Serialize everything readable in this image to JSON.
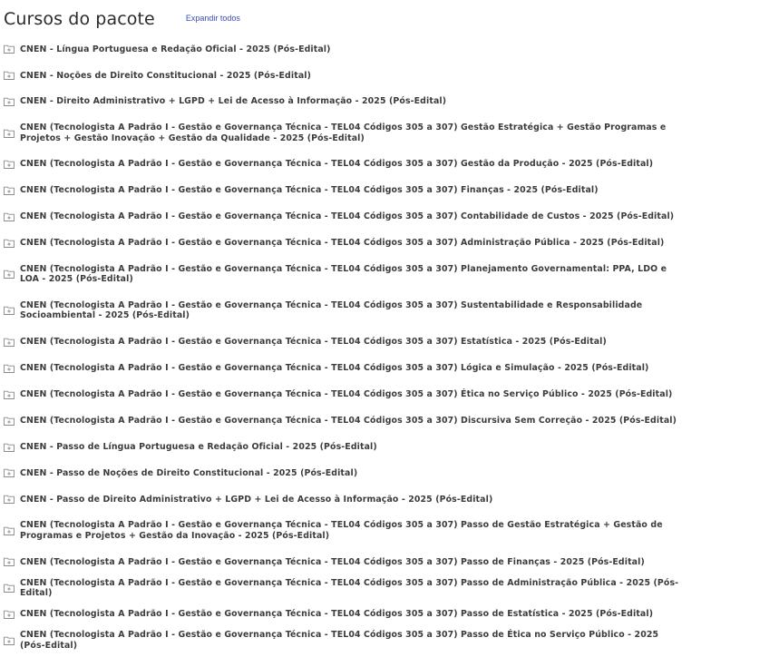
{
  "header": {
    "title": "Cursos do pacote",
    "expand_label": "Expandir todos"
  },
  "icons": {
    "item_icon": "folder-plus-icon"
  },
  "colors": {
    "link": "#3b4cb8",
    "text": "#3c3c3c",
    "icon": "#8a8a8a"
  },
  "courses": [
    "CNEN - Língua Portuguesa e Redação Oficial - 2025 (Pós-Edital)",
    "CNEN - Noções de Direito Constitucional - 2025 (Pós-Edital)",
    "CNEN - Direito Administrativo + LGPD + Lei de Acesso à Informação - 2025 (Pós-Edital)",
    "CNEN (Tecnologista A Padrão I - Gestão e Governança Técnica - TEL04 Códigos 305 a 307) Gestão Estratégica + Gestão Programas e Projetos + Gestão Inovação + Gestão da Qualidade - 2025 (Pós-Edital)",
    "CNEN (Tecnologista A Padrão I - Gestão e Governança Técnica - TEL04 Códigos 305 a 307) Gestão da Produção - 2025 (Pós-Edital)",
    "CNEN (Tecnologista A Padrão I - Gestão e Governança Técnica - TEL04 Códigos 305 a 307) Finanças - 2025 (Pós-Edital)",
    "CNEN (Tecnologista A Padrão I - Gestão e Governança Técnica - TEL04 Códigos 305 a 307) Contabilidade de Custos - 2025 (Pós-Edital)",
    "CNEN (Tecnologista A Padrão I - Gestão e Governança Técnica - TEL04 Códigos 305 a 307) Administração Pública - 2025 (Pós-Edital)",
    "CNEN (Tecnologista A Padrão I - Gestão e Governança Técnica - TEL04 Códigos 305 a 307) Planejamento Governamental: PPA, LDO e LOA - 2025 (Pós-Edital)",
    "CNEN (Tecnologista A Padrão I - Gestão e Governança Técnica - TEL04 Códigos 305 a 307) Sustentabilidade e Responsabilidade Socioambiental - 2025 (Pós-Edital)",
    "CNEN (Tecnologista A Padrão I - Gestão e Governança Técnica - TEL04 Códigos 305 a 307) Estatística - 2025 (Pós-Edital)",
    "CNEN (Tecnologista A Padrão I - Gestão e Governança Técnica - TEL04 Códigos 305 a 307) Lógica e Simulação - 2025 (Pós-Edital)",
    "CNEN (Tecnologista A Padrão I - Gestão e Governança Técnica - TEL04 Códigos 305 a 307) Ética no Serviço Público - 2025 (Pós-Edital)",
    "CNEN (Tecnologista A Padrão I - Gestão e Governança Técnica - TEL04 Códigos 305 a 307) Discursiva Sem Correção - 2025 (Pós-Edital)",
    "CNEN - Passo de Língua Portuguesa e Redação Oficial - 2025 (Pós-Edital)",
    "CNEN - Passo de Noções de Direito Constitucional - 2025 (Pós-Edital)",
    "CNEN - Passo de Direito Administrativo + LGPD + Lei de Acesso à Informação - 2025 (Pós-Edital)",
    "CNEN (Tecnologista A Padrão I - Gestão e Governança Técnica - TEL04 Códigos 305 a 307) Passo de Gestão Estratégica + Gestão de Programas e Projetos + Gestão da Inovação - 2025 (Pós-Edital)",
    "CNEN (Tecnologista A Padrão I - Gestão e Governança Técnica - TEL04 Códigos 305 a 307) Passo de Finanças - 2025 (Pós-Edital)",
    "CNEN (Tecnologista A Padrão I - Gestão e Governança Técnica - TEL04 Códigos 305 a 307) Passo de Administração Pública - 2025 (Pós-Edital)",
    "CNEN (Tecnologista A Padrão I - Gestão e Governança Técnica - TEL04 Códigos 305 a 307) Passo de Estatística - 2025 (Pós-Edital)",
    "CNEN (Tecnologista A Padrão I - Gestão e Governança Técnica - TEL04 Códigos 305 a 307) Passo de Ética no Serviço Público - 2025 (Pós-Edital)"
  ]
}
